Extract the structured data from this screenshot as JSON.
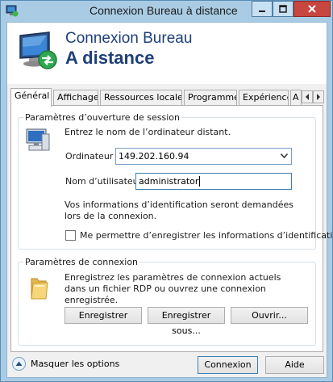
{
  "window": {
    "title": "Connexion Bureau à distance"
  },
  "banner": {
    "line1": "Connexion Bureau",
    "line2": "A distance"
  },
  "tabs": [
    {
      "label": "Général",
      "active": true
    },
    {
      "label": "Affichage",
      "active": false
    },
    {
      "label": "Ressources locales",
      "active": false
    },
    {
      "label": "Programmes",
      "active": false
    },
    {
      "label": "Expérience",
      "active": false
    },
    {
      "label": "A",
      "active": false
    }
  ],
  "logon": {
    "group_title": "Paramètres d’ouverture de session",
    "instruction": "Entrez le nom de l’ordinateur distant.",
    "computer_label": "Ordinateur :",
    "computer_value": "149.202.160.94",
    "username_label": "Nom d’utilisateur :",
    "username_value": "administrator",
    "credentials_note": "Vos informations d’identification seront demandées lors de la connexion.",
    "save_credentials_label": "Me permettre d’enregistrer les informations d’identification",
    "save_credentials_checked": false
  },
  "connection": {
    "group_title": "Paramètres de connexion",
    "description": "Enregistrez les paramètres de connexion actuels dans un fichier RDP ou ouvrez une connexion enregistrée.",
    "save_label": "Enregistrer",
    "save_as_label": "Enregistrer sous...",
    "open_label": "Ouvrir..."
  },
  "footer": {
    "hide_options_label": "Masquer les options",
    "connect_label": "Connexion",
    "help_label": "Aide"
  }
}
